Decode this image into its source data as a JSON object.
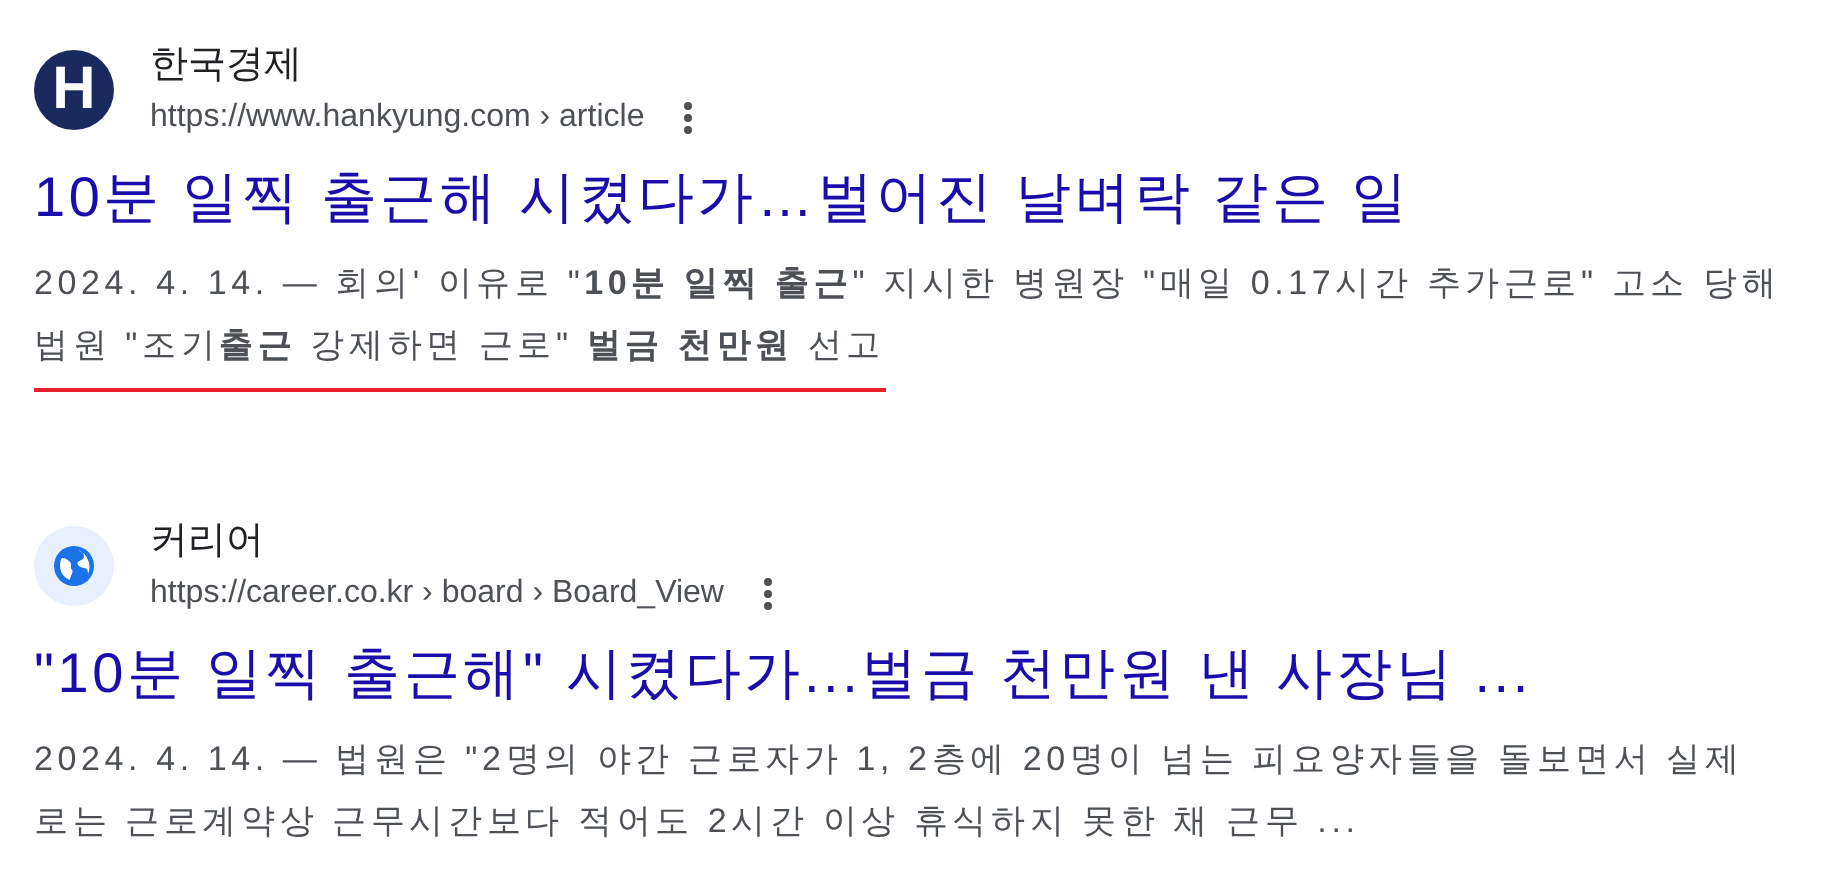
{
  "results": [
    {
      "site": "한국경제",
      "url": "https://www.hankyung.com › article",
      "favicon": {
        "kind": "letter",
        "letter": "H"
      },
      "title": "10분 일찍 출근해 시켰다가…벌어진 날벼락 같은 일",
      "snippet_lines": [
        {
          "text": "2024. 4. 14. — 회의' 이유로 \"**10분 일찍 출근**\" 지시한 병원장 \"매일 0.17시간 추가근로\" 고소 당해",
          "underlined": false
        },
        {
          "text": "법원 \"조기**출근** 강제하면 근로\" **벌금 천만원** 선고",
          "underlined": true
        }
      ]
    },
    {
      "site": "커리어",
      "url": "https://career.co.kr › board › Board_View",
      "favicon": {
        "kind": "globe"
      },
      "title": "\"10분 일찍 출근해\" 시켰다가...벌금 천만원 낸 사장님 ...",
      "snippet_lines": [
        {
          "text": "2024. 4. 14. — 법원은 \"2명의 야간 근로자가 1, 2층에 20명이 넘는 피요양자들을 돌보면서 실제",
          "underlined": false
        },
        {
          "text": "로는 근로계약상 근무시간보다 적어도 2시간 이상 휴식하지 못한 채 근무 ...",
          "underlined": false
        }
      ]
    }
  ]
}
